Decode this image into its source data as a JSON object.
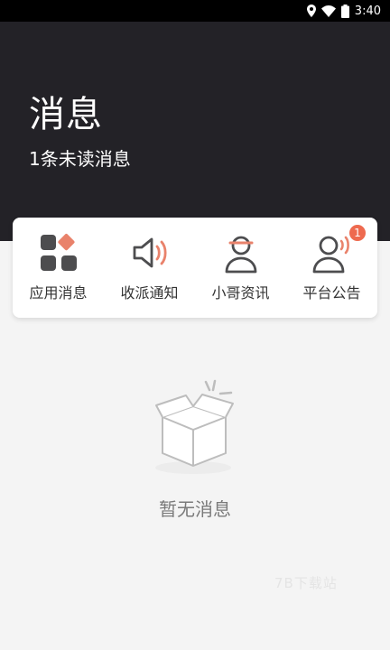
{
  "status_bar": {
    "time": "3:40"
  },
  "header": {
    "title": "消息",
    "unread_text": "1条未读消息"
  },
  "categories": [
    {
      "label": "应用消息",
      "icon": "apps-grid-icon"
    },
    {
      "label": "收派通知",
      "icon": "speaker-icon"
    },
    {
      "label": "小哥资讯",
      "icon": "courier-person-icon"
    },
    {
      "label": "平台公告",
      "icon": "announcement-person-icon",
      "badge": "1"
    }
  ],
  "empty_state": {
    "text": "暂无消息"
  },
  "watermark": "7B下载站",
  "colors": {
    "accent": "#e9826b",
    "header_bg": "#232227",
    "badge": "#ee6a4f"
  }
}
